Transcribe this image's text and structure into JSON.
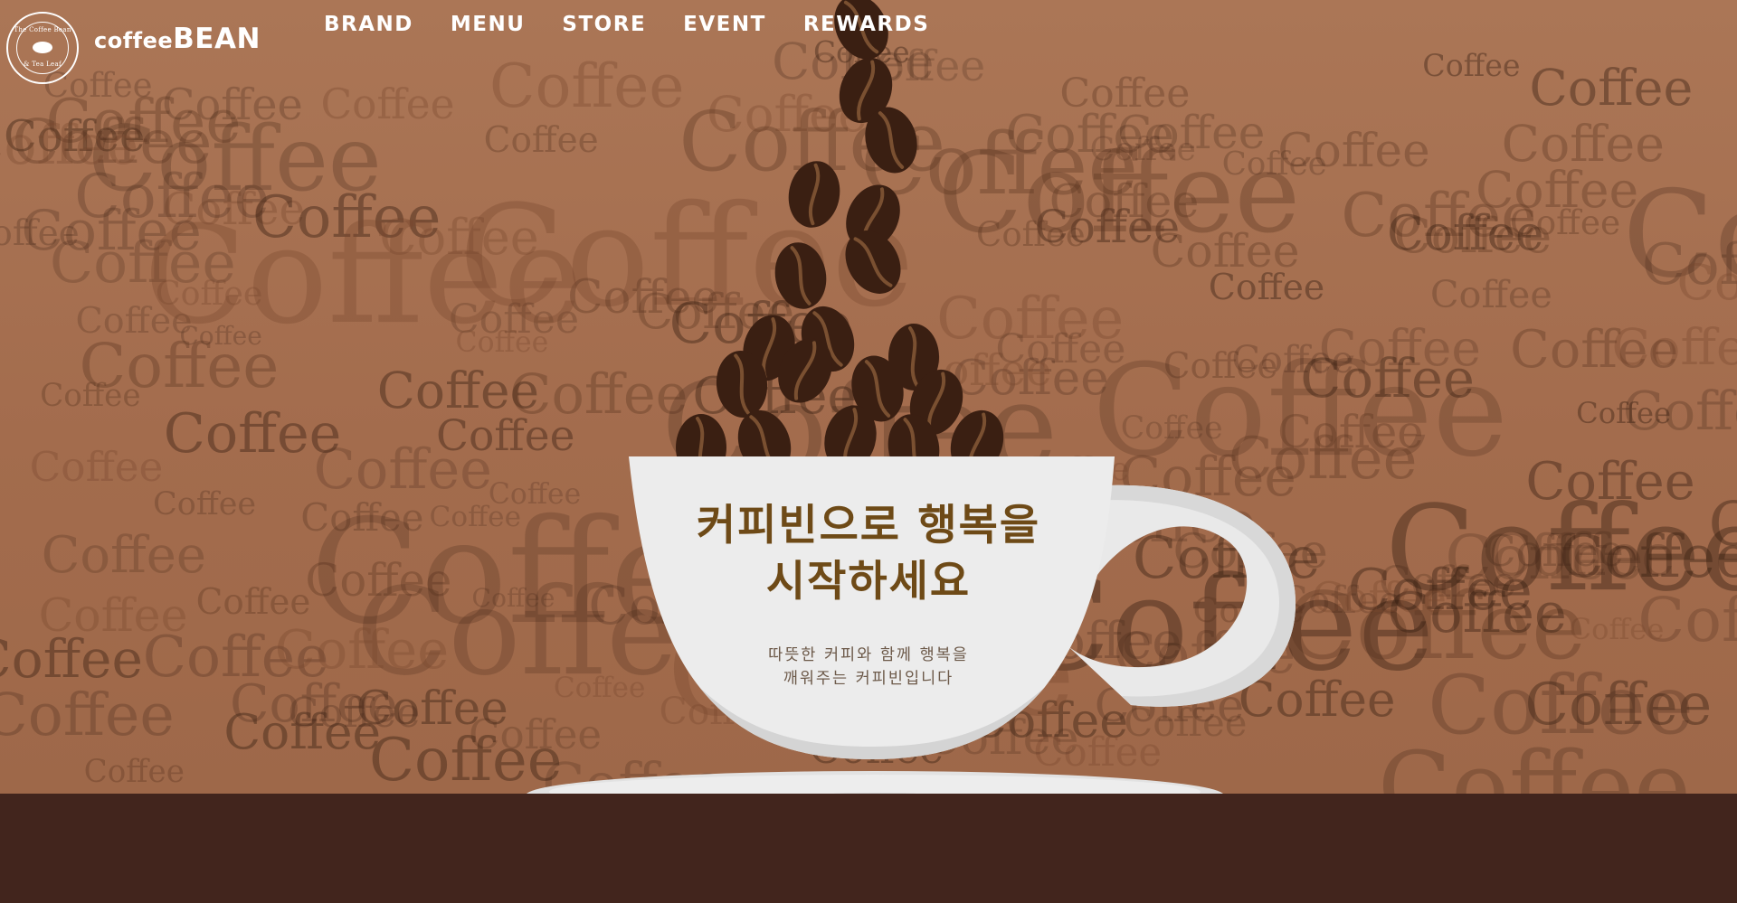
{
  "header": {
    "logo_alt": "The Coffee Bean & Tea Leaf",
    "seal_top": "The Coffee Bean",
    "seal_bottom": "& Tea Leaf",
    "brand_small": "coffee",
    "brand_big": "BEAN"
  },
  "nav": {
    "items": [
      {
        "label": "BRAND"
      },
      {
        "label": "MENU"
      },
      {
        "label": "STORE"
      },
      {
        "label": "EVENT"
      },
      {
        "label": "REWARDS"
      }
    ]
  },
  "hero": {
    "headline_line1": "커피빈으로 행복을",
    "headline_line2": "시작하세요",
    "sub_line1": "따뜻한 커피와 함께 행복을",
    "sub_line2": "깨워주는 커피빈입니다",
    "background_word": "Coffee"
  },
  "colors": {
    "background": "#a56f4e",
    "floor": "#42251d",
    "cup": "#ececec",
    "bean": "#3a1f12",
    "headline": "#6e4a17"
  }
}
